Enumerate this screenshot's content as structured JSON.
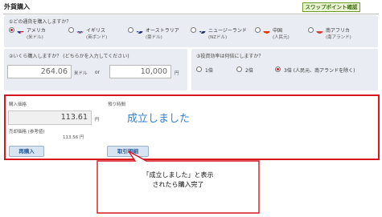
{
  "page": {
    "title": "外貨購入",
    "swap_link": "スワップポイント確認"
  },
  "currency": {
    "question": "①どの通貨を購入しますか？",
    "options": [
      {
        "name": "アメリカ",
        "sub": "(米ドル)",
        "flag": "us-flag-icon",
        "selected": true
      },
      {
        "name": "イギリス",
        "sub": "(英ポンド)",
        "flag": "uk-flag-icon",
        "selected": false
      },
      {
        "name": "オーストラリア",
        "sub": "(豪ドル)",
        "flag": "au-flag-icon",
        "selected": false
      },
      {
        "name": "ニュージーランド",
        "sub": "(NZドル)",
        "flag": "nz-flag-icon",
        "selected": false
      },
      {
        "name": "中国",
        "sub": "(人民元)",
        "flag": "cn-flag-icon",
        "selected": false
      },
      {
        "name": "南アフリカ",
        "sub": "(南アランド)",
        "flag": "za-flag-icon",
        "selected": false
      }
    ]
  },
  "amount": {
    "question": "②いくら購入しますか？ (どちらかを入力してください)",
    "foreign_value": "264.06",
    "foreign_unit": "米ドル",
    "or_label": "or",
    "yen_value": "10,000",
    "yen_unit": "円"
  },
  "leverage": {
    "question": "③投資効率は何倍にしますか？",
    "options": [
      {
        "label": "1倍",
        "selected": false
      },
      {
        "label": "2倍",
        "selected": false
      },
      {
        "label": "3倍 (人民元、南アランドを除く)",
        "selected": true
      }
    ]
  },
  "result": {
    "buy_price_label": "購入価格",
    "buy_price_value": "113.61",
    "buy_price_unit": "円",
    "sell_price_label": "売却価格 (参考値)",
    "sell_price_value": "113.56 円",
    "status_label": "預り時間",
    "status_text": "成立しました",
    "rebuy_button": "再購入",
    "details_button": "取引明細"
  },
  "callout": {
    "line1": "「成立しました」と表示",
    "line2": "されたら購入完了"
  },
  "colors": {
    "accent_red": "#d8161e",
    "link_blue": "#2f7fd1",
    "panel_bg": "#e9edf3",
    "swap_green": "#3c6b0e"
  }
}
